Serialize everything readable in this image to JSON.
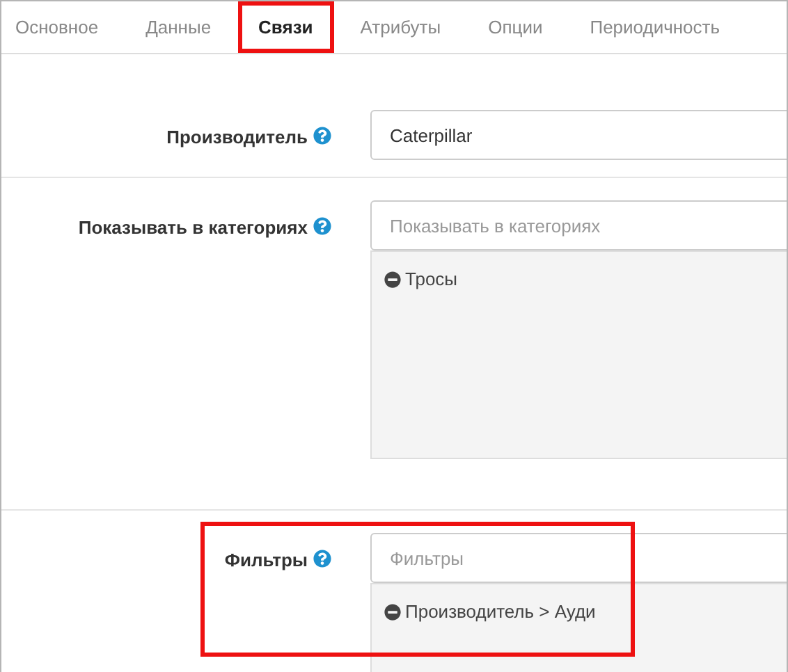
{
  "tabs": [
    {
      "label": "Основное",
      "selected": false,
      "highlighted": false
    },
    {
      "label": "Данные",
      "selected": false,
      "highlighted": false
    },
    {
      "label": "Связи",
      "selected": true,
      "highlighted": true
    },
    {
      "label": "Атрибуты",
      "selected": false,
      "highlighted": false
    },
    {
      "label": "Опции",
      "selected": false,
      "highlighted": false
    },
    {
      "label": "Периодичность",
      "selected": false,
      "highlighted": false
    }
  ],
  "fields": [
    {
      "kind": "input",
      "label": "Производитель",
      "value": "Caterpillar",
      "highlighted": false
    },
    {
      "kind": "list",
      "label": "Показывать в категориях",
      "placeholder": "Показывать в категориях",
      "items": [
        "Тросы"
      ],
      "highlighted": false
    },
    {
      "kind": "list",
      "label": "Фильтры",
      "placeholder": "Фильтры",
      "items": [
        "Производитель > Ауди"
      ],
      "highlighted": true
    }
  ]
}
